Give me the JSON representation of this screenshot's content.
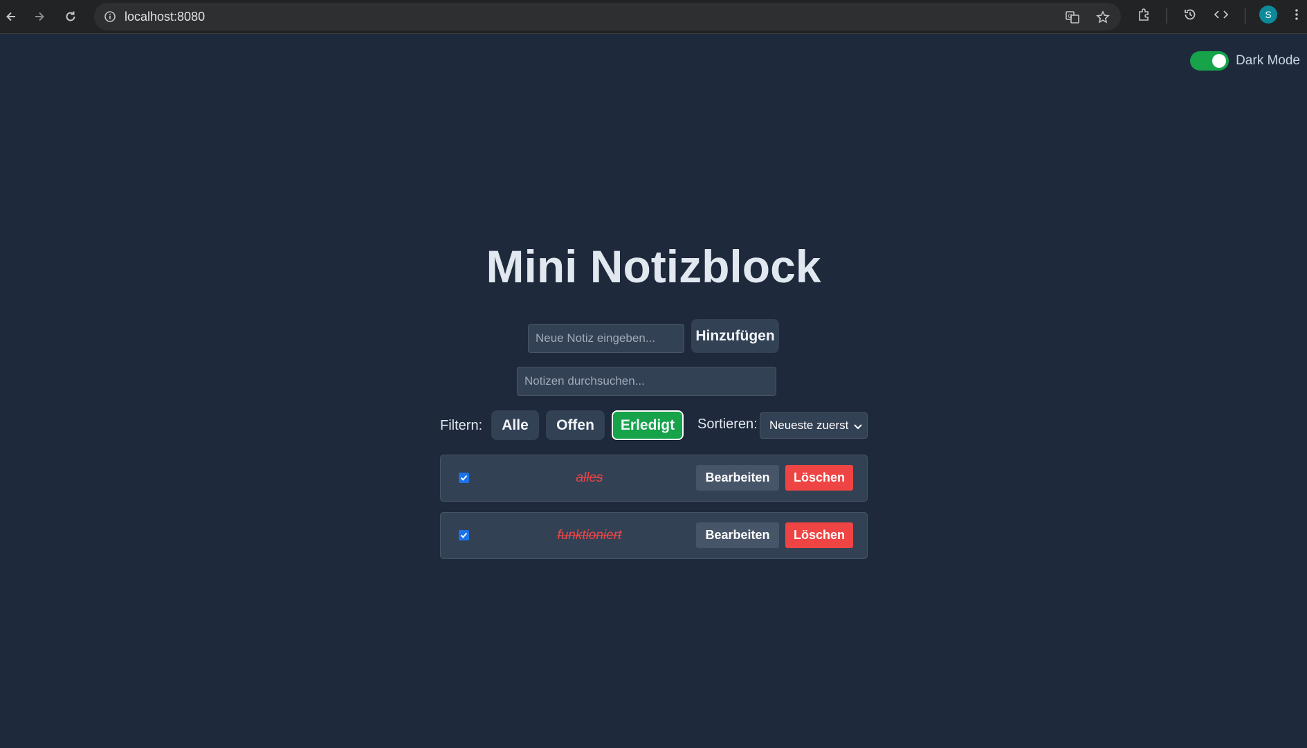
{
  "browser": {
    "url": "localhost:8080",
    "profile_initial": "S"
  },
  "dark_mode": {
    "label": "Dark Mode",
    "enabled": true
  },
  "app": {
    "title": "Mini Notizblock",
    "note_input_placeholder": "Neue Notiz eingeben...",
    "add_label": "Hinzufügen",
    "search_placeholder": "Notizen durchsuchen...",
    "filter_label": "Filtern:",
    "filters": [
      {
        "label": "Alle",
        "active": false
      },
      {
        "label": "Offen",
        "active": false
      },
      {
        "label": "Erledigt",
        "active": true
      }
    ],
    "sort_label": "Sortieren:",
    "sort_selected": "Neueste zuerst"
  },
  "notes": [
    {
      "text": "alles",
      "done": true,
      "edit_label": "Bearbeiten",
      "delete_label": "Löschen"
    },
    {
      "text": "funktioniert",
      "done": true,
      "edit_label": "Bearbeiten",
      "delete_label": "Löschen"
    }
  ],
  "colors": {
    "background": "#1e293b",
    "accent_green": "#16a34a",
    "delete_red": "#ef4444",
    "done_text": "#ef4444"
  }
}
